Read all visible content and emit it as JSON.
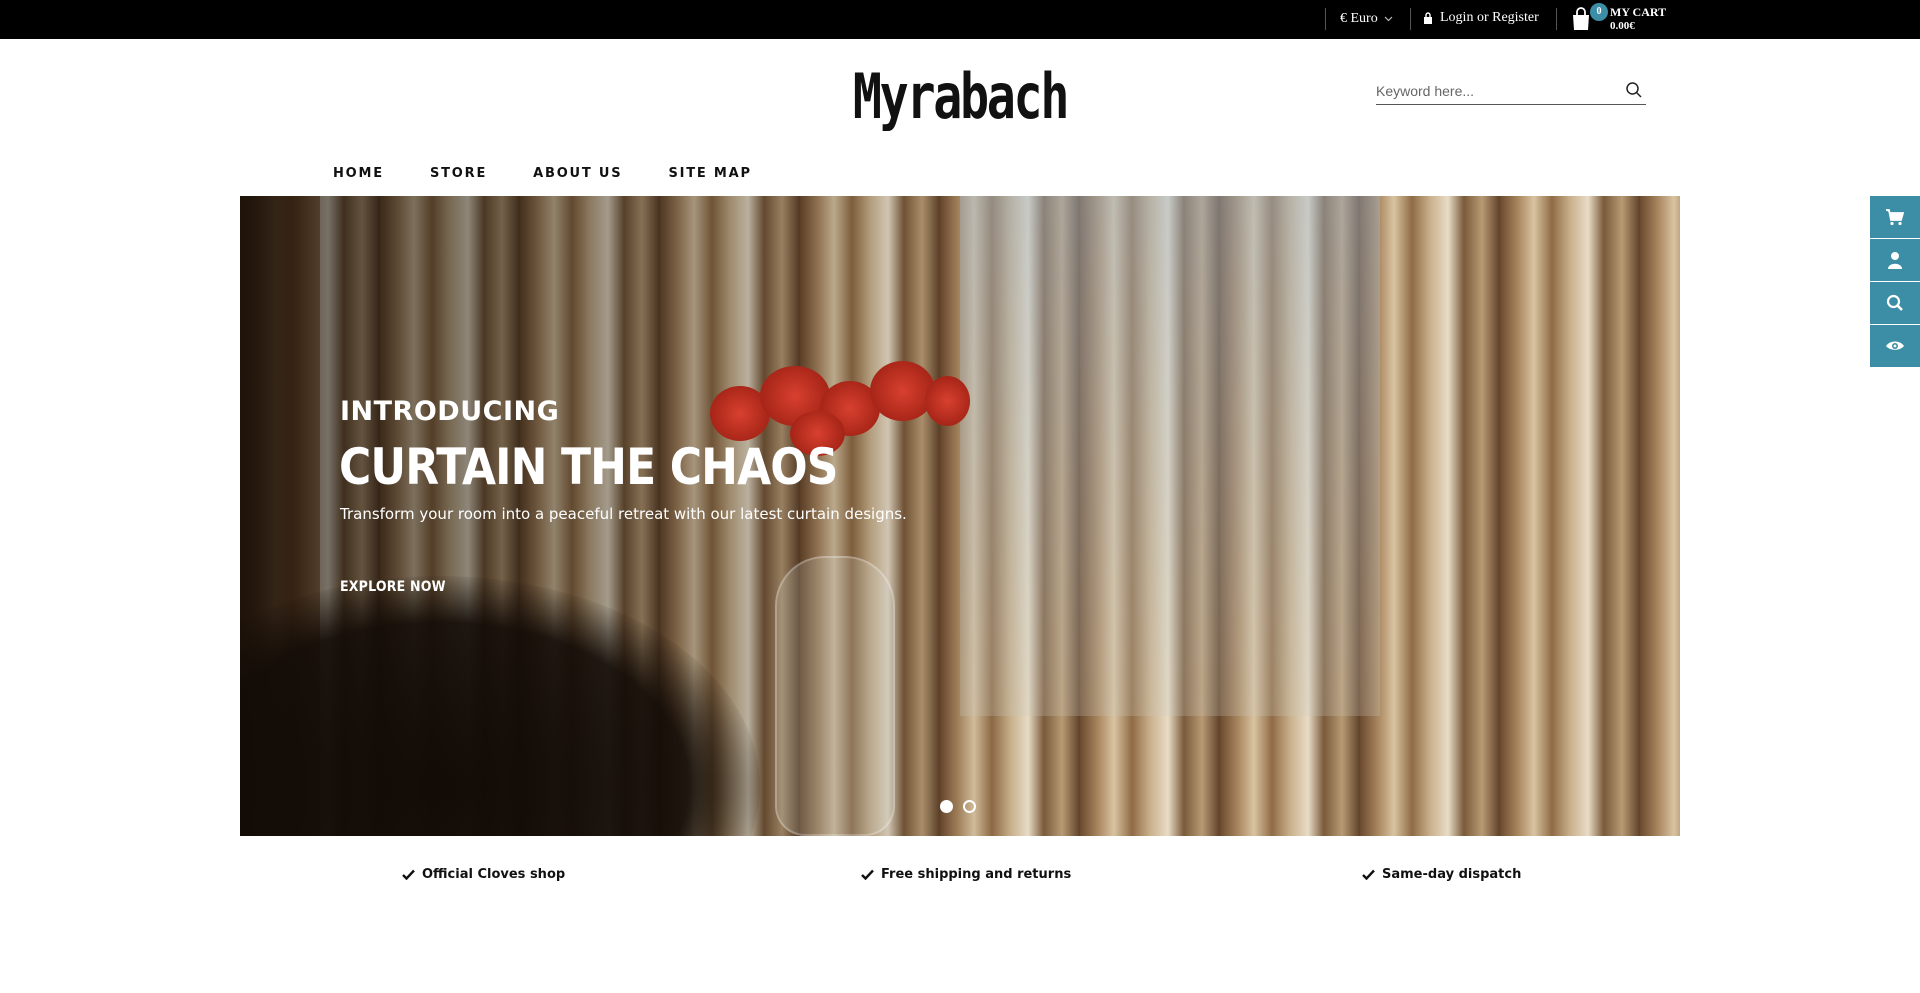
{
  "topbar": {
    "currency": "€ Euro",
    "login": "Login or Register",
    "cart": {
      "count": "0",
      "label": "MY CART",
      "total": "0.00€"
    }
  },
  "header": {
    "logo": "Myrabach",
    "search": {
      "placeholder": "Keyword here..."
    }
  },
  "nav": {
    "items": [
      {
        "label": "HOME"
      },
      {
        "label": "STORE"
      },
      {
        "label": "ABOUT US"
      },
      {
        "label": "SITE MAP"
      }
    ]
  },
  "hero": {
    "intro": "INTRODUCING",
    "title": "CURTAIN THE CHAOS",
    "subtitle": "Transform your room into a peaceful retreat with our latest curtain designs.",
    "cta": "EXPLORE NOW",
    "slides": 2,
    "active_slide": 1
  },
  "features": [
    {
      "label": "Official Cloves shop"
    },
    {
      "label": "Free shipping and returns"
    },
    {
      "label": "Same-day dispatch"
    }
  ],
  "side_toolbar": {
    "icons": [
      "cart-icon",
      "user-icon",
      "search-icon",
      "eye-icon"
    ]
  },
  "colors": {
    "accent": "#3b8ea5",
    "topbar": "#000000",
    "text": "#111111"
  }
}
